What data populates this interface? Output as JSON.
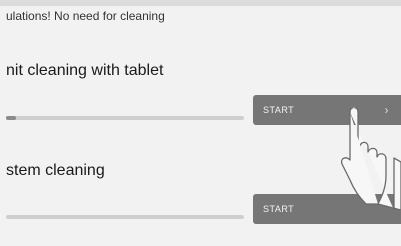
{
  "notice": {
    "text": "ulations! No need for cleaning"
  },
  "sections": [
    {
      "title": "nit cleaning with tablet",
      "progress": 0.04,
      "button_label": "START",
      "chevron": "chevron-right-icon"
    },
    {
      "title": "stem cleaning",
      "progress": 0,
      "button_label": "START"
    }
  ],
  "overlay": {
    "icon": "pointing-hand-icon"
  },
  "colors": {
    "background": "#f2f2f2",
    "button": "#767676",
    "button_text": "#f4f4f4",
    "track": "#cfcfcf",
    "track_fill": "#8a8a8a"
  }
}
